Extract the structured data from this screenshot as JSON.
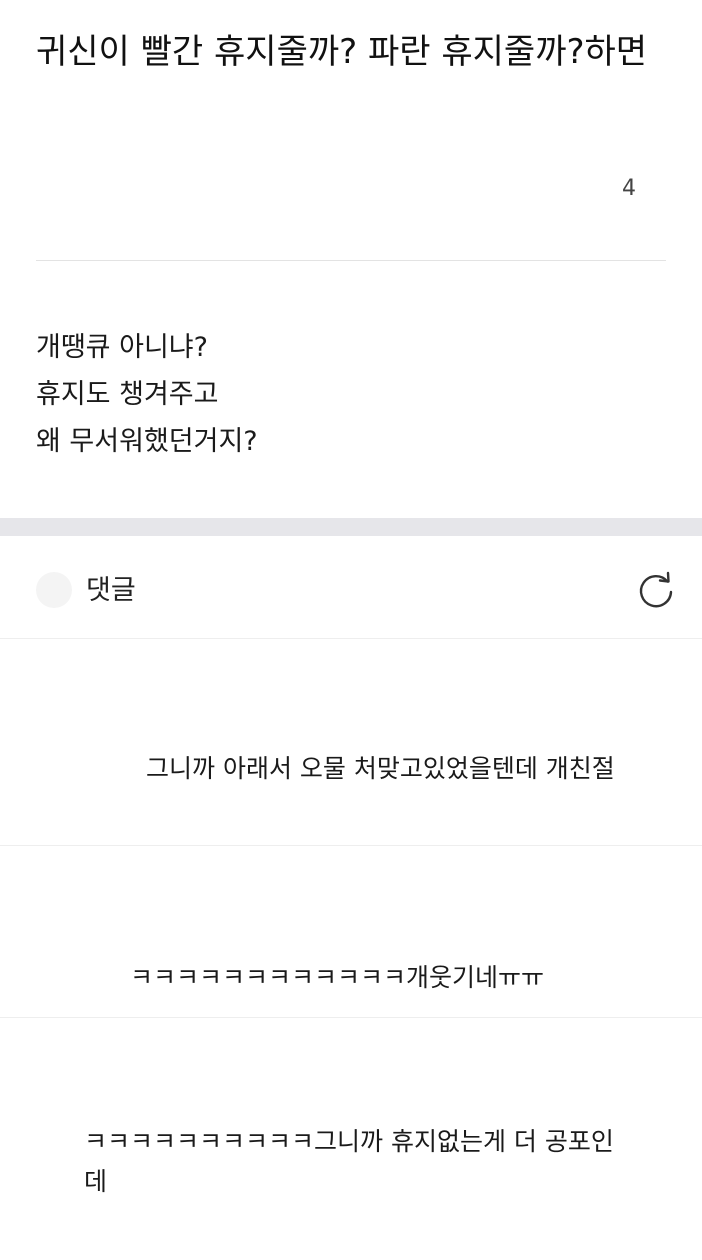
{
  "post": {
    "title": "귀신이 빨간 휴지줄까? 파란 휴지줄까?하면",
    "comment_count": "4",
    "body_lines": [
      "개땡큐 아니냐?",
      "휴지도 챙겨주고",
      "왜 무서워했던거지?"
    ]
  },
  "comments_section": {
    "label": "댓글",
    "refresh_icon": "refresh-icon"
  },
  "comments": [
    {
      "text": "그니까 아래서 오물 처맞고있었을텐데 개친절"
    },
    {
      "text": "ㅋㅋㅋㅋㅋㅋㅋㅋㅋㅋㅋㅋ개웃기네ㅠㅠ"
    },
    {
      "text": "ㅋㅋㅋㅋㅋㅋㅋㅋㅋㅋ그니까 휴지없는게 더 공포인데"
    }
  ]
}
